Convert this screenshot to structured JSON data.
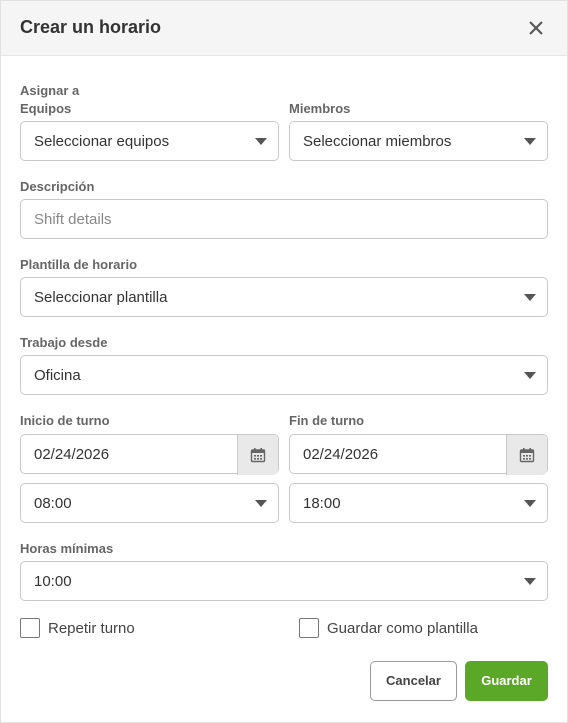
{
  "header": {
    "title": "Crear un horario"
  },
  "assign": {
    "section_label": "Asignar a",
    "teams_label": "Equipos",
    "teams_value": "Seleccionar equipos",
    "members_label": "Miembros",
    "members_value": "Seleccionar miembros"
  },
  "description": {
    "label": "Descripción",
    "placeholder": "Shift details"
  },
  "template": {
    "label": "Plantilla de horario",
    "value": "Seleccionar plantilla"
  },
  "work_from": {
    "label": "Trabajo desde",
    "value": "Oficina"
  },
  "shift_start": {
    "label": "Inicio de turno",
    "date": "02/24/2026",
    "time": "08:00"
  },
  "shift_end": {
    "label": "Fin de turno",
    "date": "02/24/2026",
    "time": "18:00"
  },
  "min_hours": {
    "label": "Horas mínimas",
    "value": "10:00"
  },
  "options": {
    "repeat_label": "Repetir turno",
    "save_template_label": "Guardar como plantilla"
  },
  "buttons": {
    "cancel": "Cancelar",
    "save": "Guardar"
  },
  "colors": {
    "primary_green": "#5ba829",
    "header_bg": "#f5f5f5"
  }
}
